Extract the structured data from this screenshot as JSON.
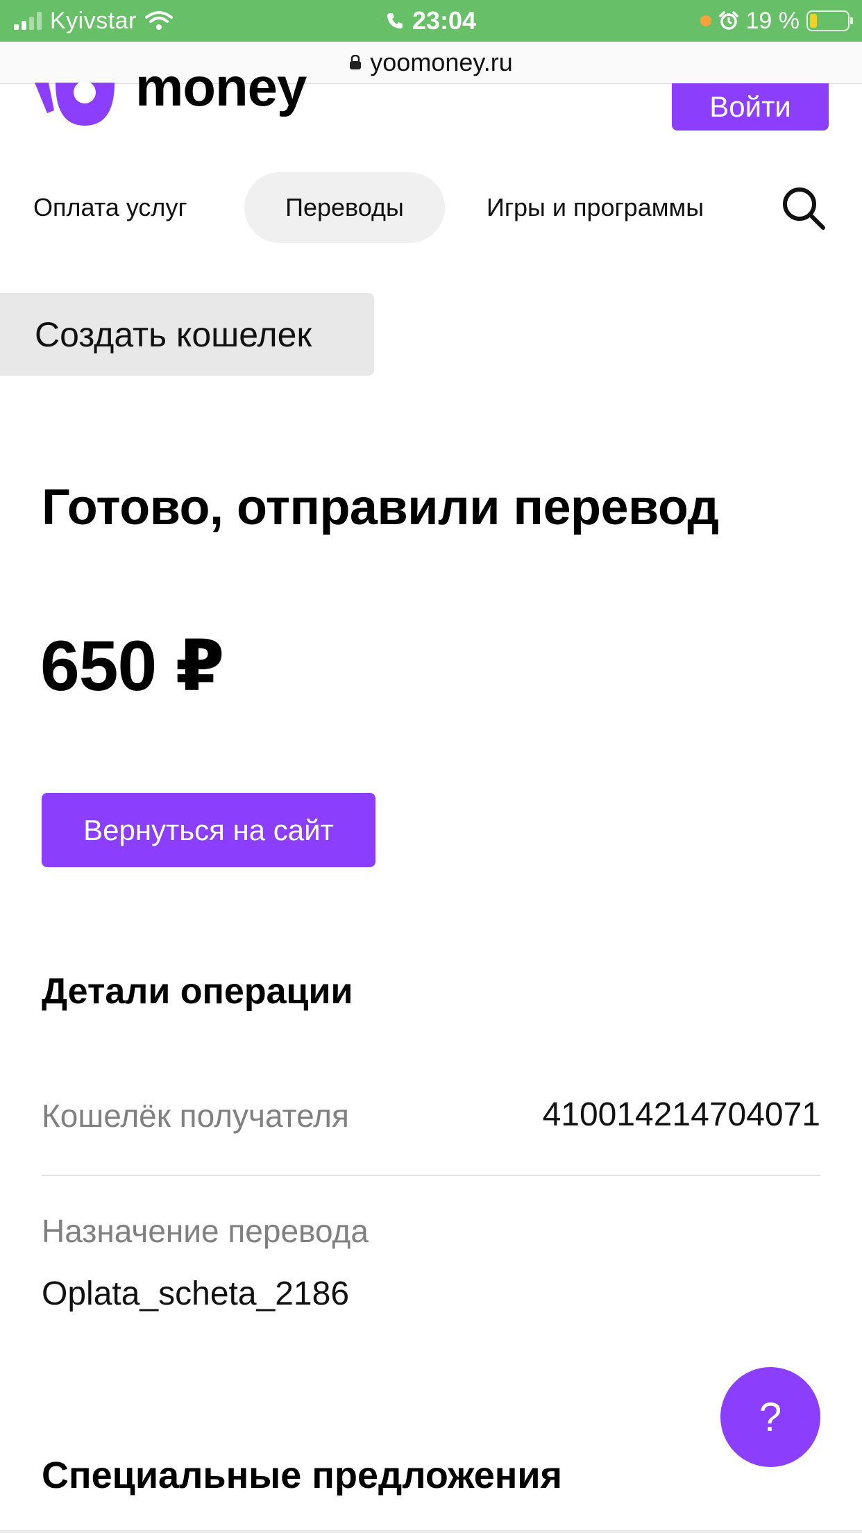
{
  "status_bar": {
    "carrier": "Kyivstar",
    "time": "23:04",
    "battery": "19 %",
    "battery_level": 0.19,
    "bar_color": "#67c067"
  },
  "browser": {
    "url": "yoomoney.ru"
  },
  "header": {
    "logo_text": "money",
    "login_label": "Войти"
  },
  "nav": {
    "items": [
      {
        "label": "Оплата услуг",
        "active": false
      },
      {
        "label": "Переводы",
        "active": true
      },
      {
        "label": "Игры и программы",
        "active": false
      }
    ],
    "search_icon": "search-icon"
  },
  "create_wallet_label": "Создать кошелек",
  "result": {
    "title": "Готово, отправили перевод",
    "amount": "650 ₽",
    "return_button": "Вернуться на сайт"
  },
  "details": {
    "title": "Детали операции",
    "recipient_label": "Кошелёк получателя",
    "recipient_value": "410014214704071",
    "purpose_label": "Назначение перевода",
    "purpose_value": "Oplata_scheta_2186"
  },
  "help_label": "?",
  "special_offers_title": "Специальные предложения",
  "colors": {
    "accent": "#8b3ffd",
    "status_bar": "#67c067",
    "muted_text": "#808080"
  }
}
